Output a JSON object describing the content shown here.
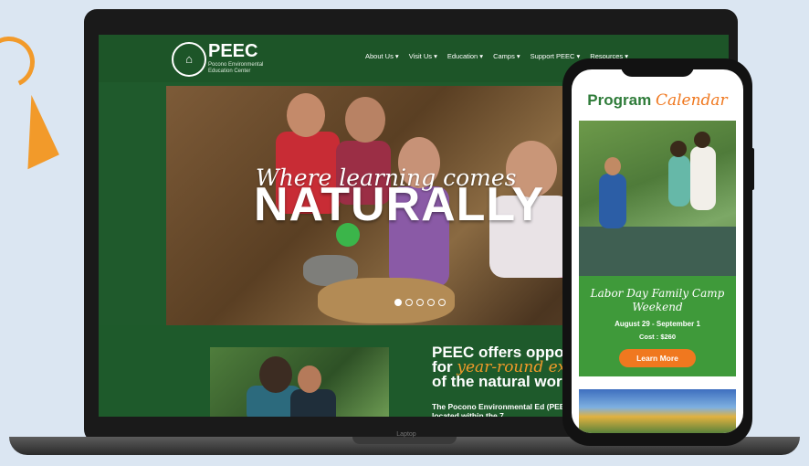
{
  "site": {
    "logo_mark": "⌂",
    "title": "PEEC",
    "subtitle": "Pocono Environmental Education Center",
    "menu": [
      "About Us ▾",
      "Visit Us ▾",
      "Education ▾",
      "Camps ▾",
      "Support PEEC ▾",
      "Resources ▾"
    ]
  },
  "hero": {
    "tagline_top": "Where learning comes",
    "tagline_big": "NATURALLY",
    "slide_count": 5,
    "active_slide": 1
  },
  "content": {
    "offer_line1": "PEEC offers oppo",
    "offer_line2_prefix": "for ",
    "offer_line2_orange": "year-round explor",
    "offer_line3": "of the natural wor",
    "body": "The Pocono Environmental Ed (PEEC) is located within the 7"
  },
  "laptop": {
    "brand": "Laptop"
  },
  "phone": {
    "title_part1": "Program",
    "title_part2": "Calendar",
    "event_title": "Labor Day Family Camp Weekend",
    "event_dates": "August 29 - September 1",
    "event_cost": "Cost : $260",
    "button_label": "Learn More"
  }
}
